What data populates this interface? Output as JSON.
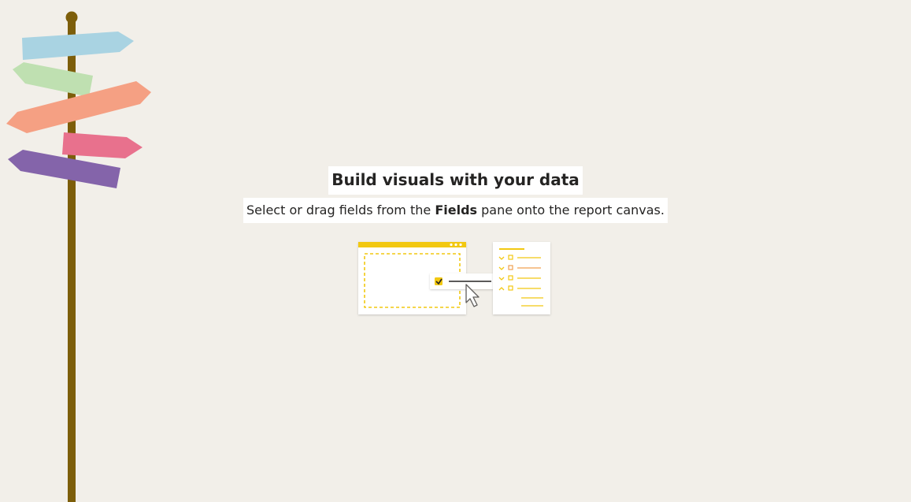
{
  "empty_state": {
    "title": "Build visuals with your data",
    "subtitle_before": "Select or drag fields from the ",
    "subtitle_bold": "Fields",
    "subtitle_after": " pane onto the report canvas."
  },
  "decor": {
    "signpost_icon": "signpost-icon",
    "illustration_icon": "drag-fields-illustration-icon",
    "colors": {
      "background": "#f2efe9",
      "pole": "#7d5e0a",
      "sign_blue": "#a9d3e2",
      "sign_green": "#bfe0b1",
      "sign_orange": "#f5a083",
      "sign_pink": "#e8718d",
      "sign_purple": "#8464aa",
      "accent_yellow": "#f2c811",
      "accent_orange": "#f0a050"
    }
  }
}
